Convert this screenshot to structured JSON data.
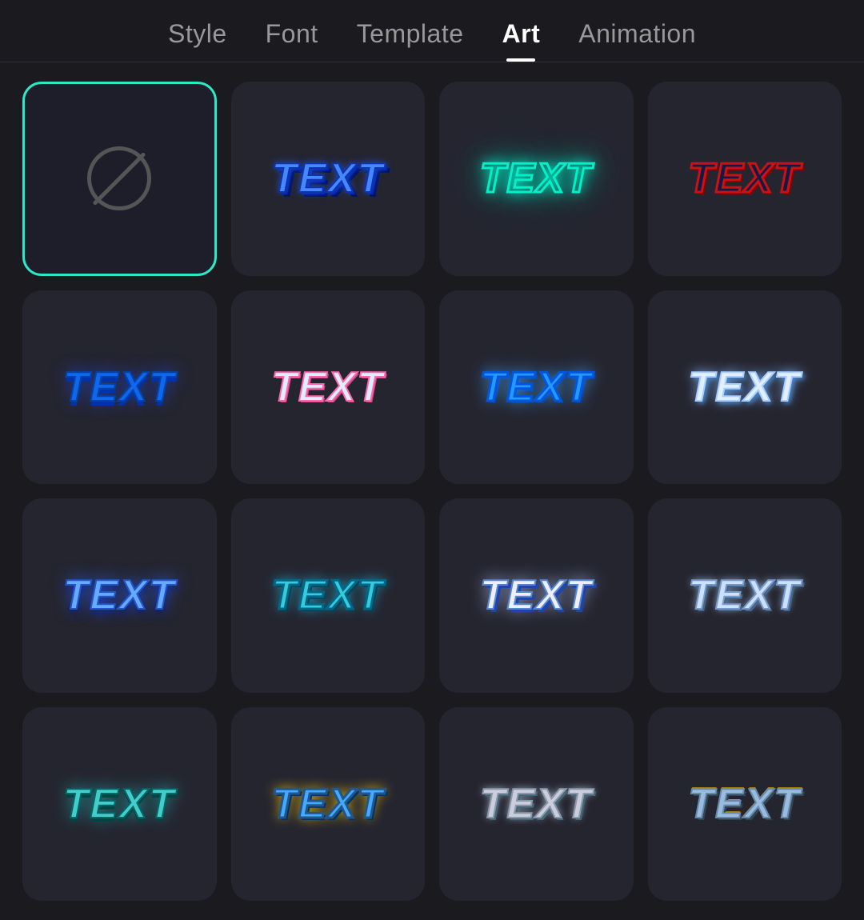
{
  "nav": {
    "tabs": [
      {
        "id": "style",
        "label": "Style",
        "active": false
      },
      {
        "id": "font",
        "label": "Font",
        "active": false
      },
      {
        "id": "template",
        "label": "Template",
        "active": false
      },
      {
        "id": "art",
        "label": "Art",
        "active": true
      },
      {
        "id": "animation",
        "label": "Animation",
        "active": false
      }
    ]
  },
  "grid": {
    "cards": [
      {
        "id": "none",
        "type": "none",
        "label": ""
      },
      {
        "id": "style1",
        "type": "text",
        "label": "TEXT",
        "styleClass": "style-blue-3d"
      },
      {
        "id": "style2",
        "type": "text",
        "label": "TEXT",
        "styleClass": "style-cyan-neon"
      },
      {
        "id": "style3",
        "type": "text",
        "label": "TEXT",
        "styleClass": "style-dark-red"
      },
      {
        "id": "style4",
        "type": "text",
        "label": "TEXT",
        "styleClass": "style-blue-bold"
      },
      {
        "id": "style5",
        "type": "text",
        "label": "TEXT",
        "styleClass": "style-pink-outline"
      },
      {
        "id": "style6",
        "type": "text",
        "label": "TEXT",
        "styleClass": "style-bright-blue"
      },
      {
        "id": "style7",
        "type": "text",
        "label": "TEXT",
        "styleClass": "style-light-blue-white"
      },
      {
        "id": "style8",
        "type": "text",
        "label": "TEXT",
        "styleClass": "style-grad-blue-glow"
      },
      {
        "id": "style9",
        "type": "text",
        "label": "TEXT",
        "styleClass": "style-teal-outline"
      },
      {
        "id": "style10",
        "type": "text",
        "label": "TEXT",
        "styleClass": "style-white-dark-shadow"
      },
      {
        "id": "style11",
        "type": "text",
        "label": "TEXT",
        "styleClass": "style-silver-blue"
      },
      {
        "id": "style12",
        "type": "text",
        "label": "TEXT",
        "styleClass": "style-cyan-grad"
      },
      {
        "id": "style13",
        "type": "text",
        "label": "TEXT",
        "styleClass": "style-yellow-blue"
      },
      {
        "id": "style14",
        "type": "text",
        "label": "TEXT",
        "styleClass": "style-gray-white"
      },
      {
        "id": "style15",
        "type": "text",
        "label": "TEXT",
        "styleClass": "style-silver-gold"
      }
    ]
  },
  "colors": {
    "background": "#1a1a1f",
    "card": "#252530",
    "active_border": "#2de8c8",
    "nav_active": "#ffffff",
    "nav_inactive": "#999999"
  }
}
